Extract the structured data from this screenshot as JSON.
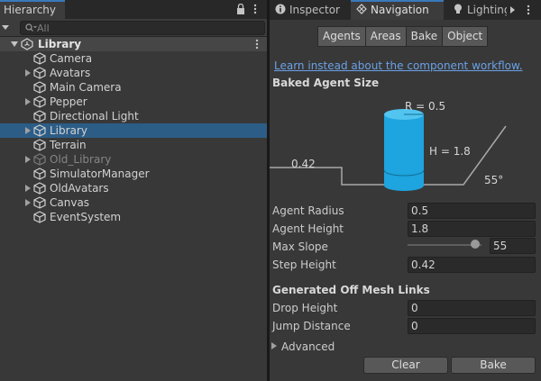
{
  "hierarchy": {
    "tab_label": "Hierarchy",
    "search_placeholder": "All",
    "scene_name": "Library",
    "items": [
      {
        "label": "Camera",
        "expandable": false,
        "selected": false,
        "disabled": false
      },
      {
        "label": "Avatars",
        "expandable": true,
        "selected": false,
        "disabled": false
      },
      {
        "label": "Main Camera",
        "expandable": false,
        "selected": false,
        "disabled": false
      },
      {
        "label": "Pepper",
        "expandable": true,
        "selected": false,
        "disabled": false
      },
      {
        "label": "Directional Light",
        "expandable": false,
        "selected": false,
        "disabled": false
      },
      {
        "label": "Library",
        "expandable": true,
        "selected": true,
        "disabled": false
      },
      {
        "label": "Terrain",
        "expandable": false,
        "selected": false,
        "disabled": false
      },
      {
        "label": "Old_Library",
        "expandable": true,
        "selected": false,
        "disabled": true
      },
      {
        "label": "SimulatorManager",
        "expandable": false,
        "selected": false,
        "disabled": false
      },
      {
        "label": "OldAvatars",
        "expandable": true,
        "selected": false,
        "disabled": false
      },
      {
        "label": "Canvas",
        "expandable": true,
        "selected": false,
        "disabled": false
      },
      {
        "label": "EventSystem",
        "expandable": false,
        "selected": false,
        "disabled": false
      }
    ]
  },
  "inspector": {
    "tabs": [
      {
        "label": "Inspector",
        "icon": "info-icon",
        "active": false
      },
      {
        "label": "Navigation",
        "icon": "navigation-compass-icon",
        "active": true
      },
      {
        "label": "Lighting",
        "icon": "lightbulb-icon",
        "active": false
      }
    ],
    "nav_tabs": [
      "Agents",
      "Areas",
      "Bake",
      "Object"
    ],
    "active_nav_tab": "Bake",
    "learn_link": "Learn instead about the component workflow.",
    "baked_agent_size_title": "Baked Agent Size",
    "diagram": {
      "radius_label": "R = 0.5",
      "height_label": "H = 1.8",
      "step_label": "0.42",
      "slope_label": "55°"
    },
    "properties": {
      "agent_radius": {
        "label": "Agent Radius",
        "value": "0.5"
      },
      "agent_height": {
        "label": "Agent Height",
        "value": "1.8"
      },
      "max_slope": {
        "label": "Max Slope",
        "value": "55",
        "slider_fraction": 0.92
      },
      "step_height": {
        "label": "Step Height",
        "value": "0.42"
      }
    },
    "offmesh_title": "Generated Off Mesh Links",
    "offmesh": {
      "drop_height": {
        "label": "Drop Height",
        "value": "0"
      },
      "jump_distance": {
        "label": "Jump Distance",
        "value": "0"
      }
    },
    "advanced_label": "Advanced",
    "clear_label": "Clear",
    "bake_label": "Bake"
  },
  "colors": {
    "accent": "#3a79bb",
    "selection": "#2c5d87",
    "link": "#6aa1e6",
    "agent_cylinder": "#1ea4de"
  }
}
